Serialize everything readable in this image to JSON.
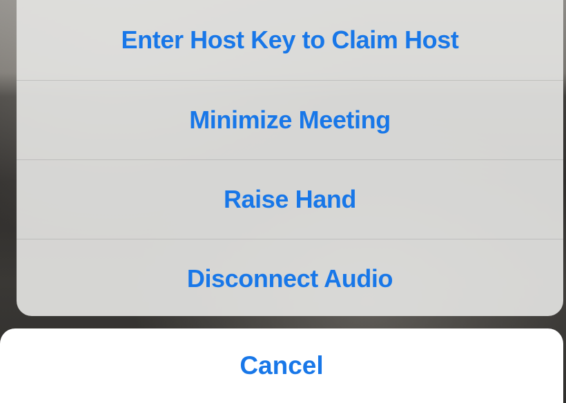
{
  "action_sheet": {
    "items": [
      {
        "label": "Enter Host Key to Claim Host"
      },
      {
        "label": "Minimize Meeting"
      },
      {
        "label": "Raise Hand"
      },
      {
        "label": "Disconnect Audio"
      }
    ],
    "cancel_label": "Cancel"
  },
  "colors": {
    "action_text": "#1877e8",
    "sheet_background": "#e2e2e0",
    "cancel_background": "#ffffff"
  }
}
